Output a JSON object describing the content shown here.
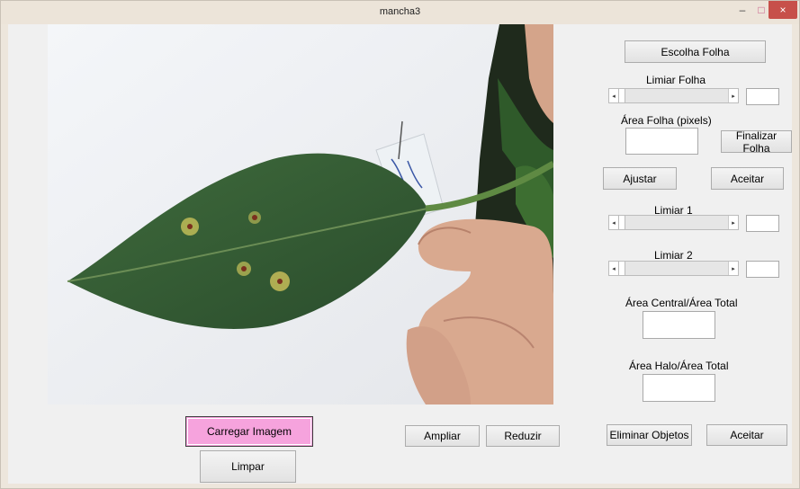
{
  "window": {
    "title": "mancha3",
    "minimize_glyph": "–",
    "maximize_glyph": "□",
    "close_glyph": "×"
  },
  "image_panel": {
    "icons": [
      "leaf-photo"
    ]
  },
  "left_buttons": {
    "load_image": "Carregar Imagem",
    "clear": "Limpar",
    "zoom_in": "Ampliar",
    "zoom_out": "Reduzir"
  },
  "right_panel": {
    "choose_leaf": "Escolha Folha",
    "leaf_threshold_label": "Limiar Folha",
    "leaf_threshold_value": "",
    "leaf_area_label": "Área Folha (pixels)",
    "leaf_area_value": "",
    "finish_leaf": "Finalizar Folha",
    "adjust": "Ajustar",
    "accept_1": "Aceitar",
    "threshold1_label": "Limiar 1",
    "threshold1_value": "",
    "threshold2_label": "Limiar 2",
    "threshold2_value": "",
    "central_area_label": "Área Central/Área Total",
    "central_area_value": "",
    "halo_area_label": "Área Halo/Área Total",
    "halo_area_value": "",
    "remove_objects": "Eliminar Objetos",
    "accept_2": "Aceitar"
  },
  "colors": {
    "load_button": "#f6a3dd",
    "close_button": "#c7504a"
  }
}
